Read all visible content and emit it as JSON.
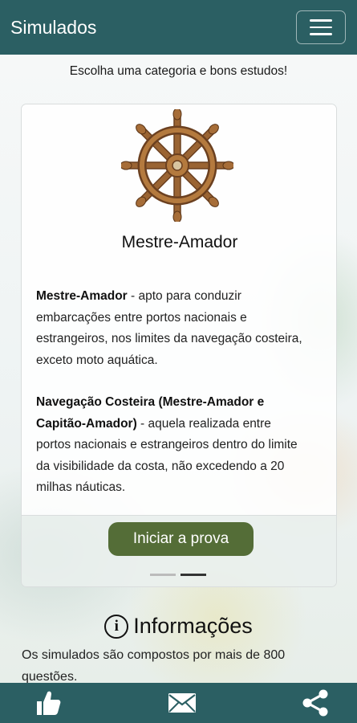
{
  "header": {
    "title": "Simulados",
    "menu_icon": "hamburger-menu-icon"
  },
  "subtitle": "Escolha uma categoria e bons estudos!",
  "card": {
    "image_icon": "ship-wheel-icon",
    "title": "Mestre-Amador",
    "paragraphs": [
      {
        "bold": "Mestre-Amador",
        "text": " - apto para conduzir embarcações entre portos nacionais e estrangeiros, nos limites da navegação costeira, exceto moto aquática."
      },
      {
        "bold": "Navegação Costeira (Mestre-Amador e Capitão-Amador)",
        "text": " - aquela realizada entre portos nacionais e estrangeiros dentro do limite da visibilidade da costa, não excedendo a 20 milhas náuticas."
      }
    ],
    "button_label": "Iniciar a prova",
    "carousel": {
      "count": 2,
      "active_index": 1
    }
  },
  "info": {
    "icon": "info-circle-icon",
    "icon_glyph": "i",
    "title": "Informações",
    "text": "Os simulados são compostos por mais de 800 questões."
  },
  "bottom_nav": {
    "items": [
      {
        "icon": "thumbs-up-icon"
      },
      {
        "icon": "mail-icon"
      },
      {
        "icon": "share-icon"
      }
    ]
  },
  "colors": {
    "primary": "#2b5f63",
    "button": "#546d37",
    "wheel": "#8a5a2b"
  }
}
